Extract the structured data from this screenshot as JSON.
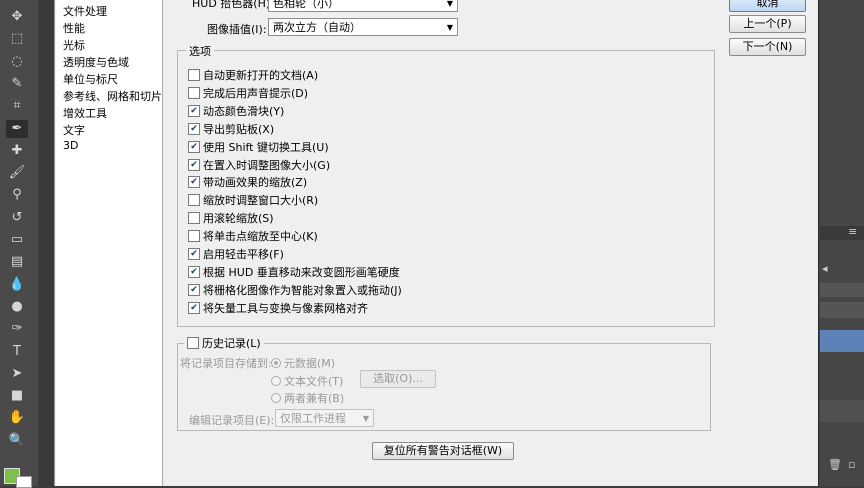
{
  "toolbar": {
    "tools": [
      "move-tool-icon",
      "marquee-icon",
      "lasso-icon",
      "quick-select-icon",
      "crop-icon",
      "eyedropper-icon",
      "healing-brush-icon",
      "brush-icon",
      "clone-stamp-icon",
      "history-brush-icon",
      "eraser-icon",
      "gradient-icon",
      "blur-icon",
      "dodge-icon",
      "pen-icon",
      "type-icon",
      "path-select-icon",
      "shape-icon",
      "hand-icon",
      "zoom-icon"
    ],
    "foreground_color": "#7fbf4a",
    "background_color": "#ffffff"
  },
  "categories": [
    "文件处理",
    "性能",
    "光标",
    "透明度与色域",
    "单位与标尺",
    "参考线、网格和切片",
    "增效工具",
    "文字",
    "3D"
  ],
  "top_fields": {
    "hud_label": "HUD 拾色器(H):",
    "hud_value": "色相轮（小）",
    "interp_label": "图像插值(I):",
    "interp_value": "两次立方（自动）"
  },
  "options": {
    "legend": "选项",
    "items": [
      {
        "label": "自动更新打开的文档(A)",
        "checked": false
      },
      {
        "label": "完成后用声音提示(D)",
        "checked": false
      },
      {
        "label": "动态颜色滑块(Y)",
        "checked": true
      },
      {
        "label": "导出剪贴板(X)",
        "checked": true
      },
      {
        "label": "使用 Shift 键切换工具(U)",
        "checked": true
      },
      {
        "label": "在置入时调整图像大小(G)",
        "checked": true
      },
      {
        "label": "带动画效果的缩放(Z)",
        "checked": true
      },
      {
        "label": "缩放时调整窗口大小(R)",
        "checked": false
      },
      {
        "label": "用滚轮缩放(S)",
        "checked": false
      },
      {
        "label": "将单击点缩放至中心(K)",
        "checked": false
      },
      {
        "label": "启用轻击平移(F)",
        "checked": true
      },
      {
        "label": "根据 HUD 垂直移动来改变圆形画笔硬度",
        "checked": true
      },
      {
        "label": "将栅格化图像作为智能对象置入或拖动(J)",
        "checked": true
      },
      {
        "label": "将矢量工具与变换与像素网格对齐",
        "checked": true
      }
    ]
  },
  "history": {
    "legend": "历史记录(L)",
    "save_to_label": "将记录项目存储到:",
    "radios": [
      "元数据(M)",
      "文本文件(T)",
      "两者兼有(B)"
    ],
    "choose_button": "选取(O)...",
    "edit_label": "编辑记录项目(E):",
    "edit_value": "仅限工作进程"
  },
  "reset_button": "复位所有警告对话框(W)",
  "buttons": {
    "cancel": "取消",
    "prev": "上一个(P)",
    "next": "下一个(N)"
  }
}
